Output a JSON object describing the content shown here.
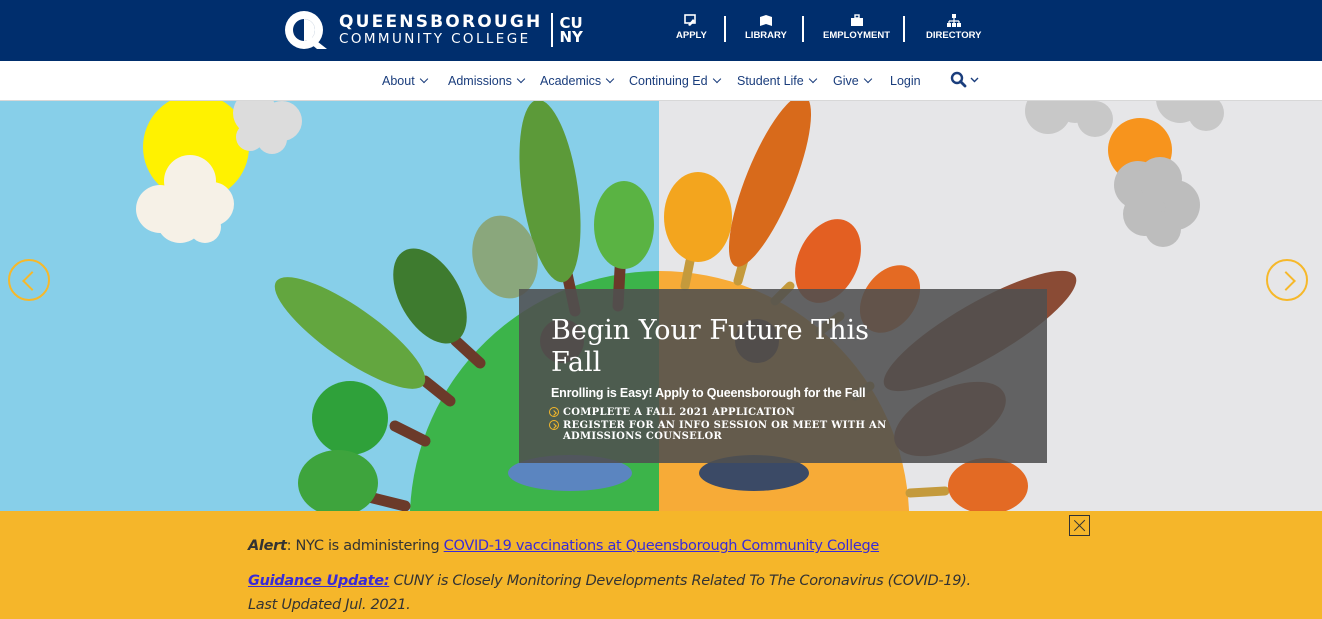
{
  "header": {
    "logo_line1": "QUEENSBOROUGH",
    "logo_line2": "COMMUNITY COLLEGE",
    "cuny_top": "CU",
    "cuny_bottom": "NY",
    "quick_links": [
      {
        "label": "APPLY",
        "icon": "apply-icon"
      },
      {
        "label": "LIBRARY",
        "icon": "library-icon"
      },
      {
        "label": "EMPLOYMENT",
        "icon": "briefcase-icon"
      },
      {
        "label": "DIRECTORY",
        "icon": "sitemap-icon"
      }
    ]
  },
  "nav": {
    "items": [
      "About",
      "Admissions",
      "Academics",
      "Continuing Ed",
      "Student Life",
      "Give",
      "Login"
    ]
  },
  "hero": {
    "title": "Begin Your Future This Fall",
    "subtitle": "Enrolling is Easy! Apply to Queensborough for the Fall",
    "links": [
      "COMPLETE A FALL 2021 APPLICATION",
      "REGISTER FOR AN INFO SESSION OR MEET WITH AN ADMISSIONS COUNSELOR"
    ]
  },
  "alert": {
    "label": "Alert",
    "text": ": NYC is administering ",
    "link": "COVID-19 vaccinations at Queensborough Community College",
    "guidance_link": "Guidance Update:",
    "guidance_text": " CUNY is Closely Monitoring Developments Related To The Coronavirus (COVID-19).",
    "updated": "Last Updated Jul. 2021."
  },
  "colors": {
    "brand_blue": "#002e6d",
    "accent_gold": "#f5b62a",
    "nav_text": "#1a3d7c"
  }
}
